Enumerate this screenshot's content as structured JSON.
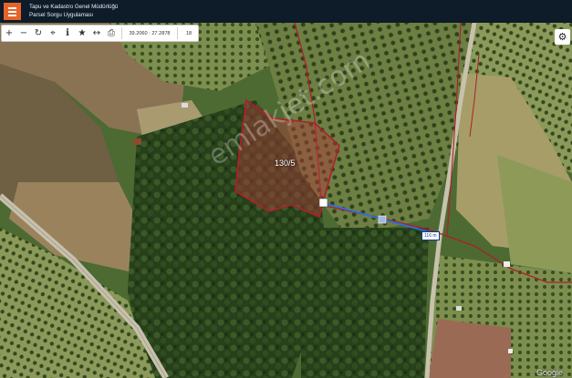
{
  "header": {
    "title_line1": "Tapu ve Kadastro Genel Müdürlüğü",
    "title_line2": "Parsel Sorgu Uygulaması",
    "menu_icon": "hamburger-icon"
  },
  "toolbar": {
    "icons": [
      "zoom-in-icon",
      "zoom-out-icon",
      "refresh-icon",
      "locate-icon",
      "info-icon",
      "favorite-star-icon",
      "measure-icon",
      "print-icon"
    ],
    "coordinates": "39.2060 : 27.2878",
    "zoom_level": "18"
  },
  "map": {
    "parcel_label": "130/5",
    "distance_label": "116 m",
    "watermark": "emlakjet.com",
    "attribution": "Google"
  },
  "colors": {
    "header_bg": "#0e1b28",
    "menu_accent": "#e8632a",
    "parcel_outline": "#b01f2a",
    "measure_line": "#2b6fe0",
    "road": "#c7c1ad"
  }
}
